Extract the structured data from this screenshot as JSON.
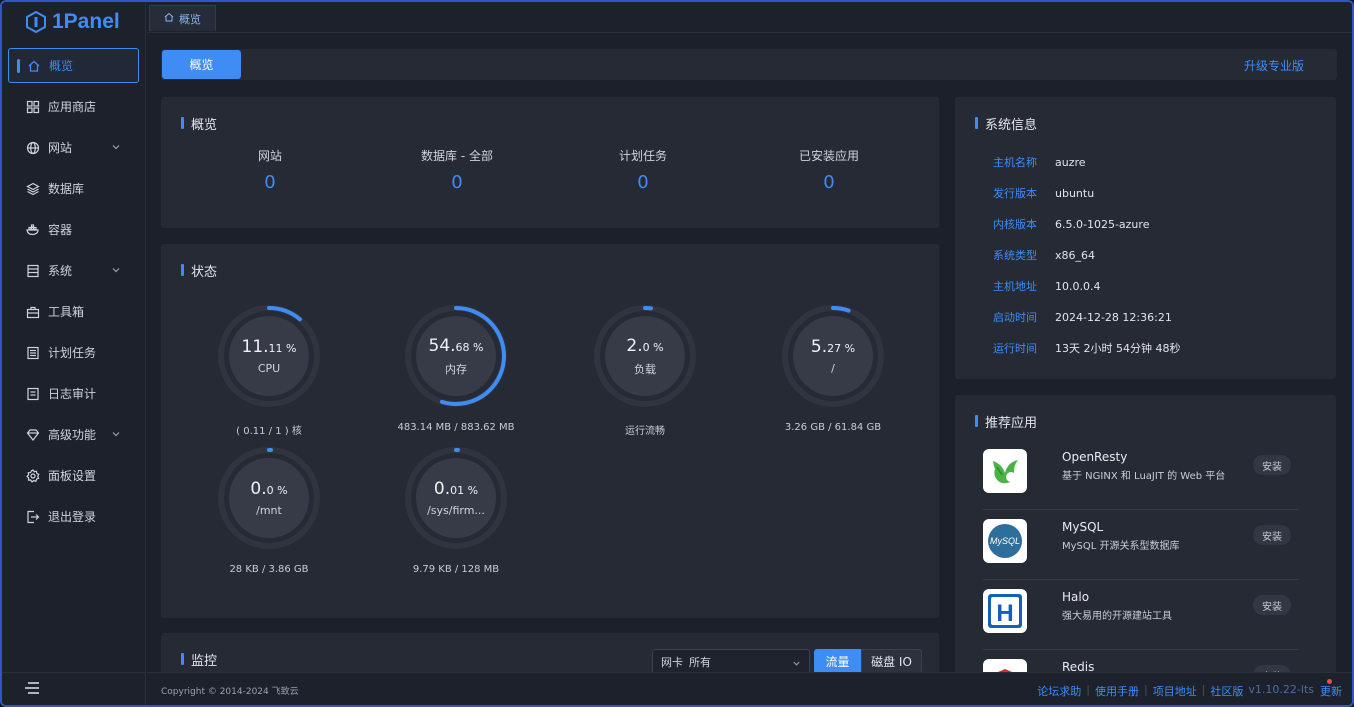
{
  "brand": {
    "name": "1Panel",
    "color": "#3f8cf5"
  },
  "sidebar": {
    "items": [
      {
        "label": "概览",
        "icon": "home-icon",
        "active": true
      },
      {
        "label": "应用商店",
        "icon": "grid-icon"
      },
      {
        "label": "网站",
        "icon": "globe-icon",
        "expandable": true
      },
      {
        "label": "数据库",
        "icon": "database-icon"
      },
      {
        "label": "容器",
        "icon": "container-icon"
      },
      {
        "label": "系统",
        "icon": "system-icon",
        "expandable": true
      },
      {
        "label": "工具箱",
        "icon": "toolbox-icon"
      },
      {
        "label": "计划任务",
        "icon": "schedule-icon"
      },
      {
        "label": "日志审计",
        "icon": "log-icon"
      },
      {
        "label": "高级功能",
        "icon": "diamond-icon",
        "expandable": true
      },
      {
        "label": "面板设置",
        "icon": "gear-icon"
      },
      {
        "label": "退出登录",
        "icon": "logout-icon"
      }
    ]
  },
  "tab": {
    "label": "概览"
  },
  "toolbar": {
    "primary_label": "概览",
    "upgrade_label": "升级专业版"
  },
  "overview": {
    "title": "概览",
    "items": [
      {
        "label": "网站",
        "value": "0"
      },
      {
        "label": "数据库 - 全部",
        "value": "0"
      },
      {
        "label": "计划任务",
        "value": "0"
      },
      {
        "label": "已安装应用",
        "value": "0"
      }
    ]
  },
  "status": {
    "title": "状态",
    "gauges": [
      {
        "int": "11.",
        "dec": "11 %",
        "name": "CPU",
        "sub": "( 0.11 / 1 ) 核",
        "percent": 11.11
      },
      {
        "int": "54.",
        "dec": "68 %",
        "name": "内存",
        "sub": "483.14 MB / 883.62 MB",
        "percent": 54.68
      },
      {
        "int": "2.",
        "dec": "0 %",
        "name": "负载",
        "sub": "运行流畅",
        "percent": 2.0
      },
      {
        "int": "5.",
        "dec": "27 %",
        "name": "/",
        "sub": "3.26 GB / 61.84 GB",
        "percent": 5.27
      },
      {
        "int": "0.",
        "dec": "0 %",
        "name": "/mnt",
        "sub": "28 KB / 3.86 GB",
        "percent": 0.0
      },
      {
        "int": "0.",
        "dec": "01 %",
        "name": "/sys/firm...",
        "sub": "9.79 KB / 128 MB",
        "percent": 0.01
      }
    ]
  },
  "sysinfo": {
    "title": "系统信息",
    "rows": [
      {
        "key": "主机名称",
        "value": "auzre"
      },
      {
        "key": "发行版本",
        "value": "ubuntu"
      },
      {
        "key": "内核版本",
        "value": "6.5.0-1025-azure"
      },
      {
        "key": "系统类型",
        "value": "x86_64"
      },
      {
        "key": "主机地址",
        "value": "10.0.0.4"
      },
      {
        "key": "启动时间",
        "value": "2024-12-28 12:36:21"
      },
      {
        "key": "运行时间",
        "value": "13天 2小时 54分钟 48秒"
      }
    ]
  },
  "apps": {
    "title": "推荐应用",
    "install_label": "安装",
    "items": [
      {
        "name": "OpenResty",
        "desc": "基于 NGINX 和 LuaJIT 的 Web 平台",
        "icon": "openresty-icon"
      },
      {
        "name": "MySQL",
        "desc": "MySQL 开源关系型数据库",
        "icon": "mysql-icon",
        "icon_text": "MySQL"
      },
      {
        "name": "Halo",
        "desc": "强大易用的开源建站工具",
        "icon": "halo-icon",
        "icon_text": "H"
      },
      {
        "name": "Redis",
        "desc": "",
        "icon": "redis-icon"
      }
    ]
  },
  "monitor": {
    "title": "监控",
    "nic_label": "网卡",
    "nic_value": "所有",
    "seg_traffic": "流量",
    "seg_disk": "磁盘 IO"
  },
  "footer": {
    "copyright": "Copyright © 2014-2024 飞致云",
    "links": [
      "论坛求助",
      "使用手册",
      "项目地址",
      "社区版"
    ],
    "version": "v1.10.22-lts",
    "update": "更新"
  }
}
